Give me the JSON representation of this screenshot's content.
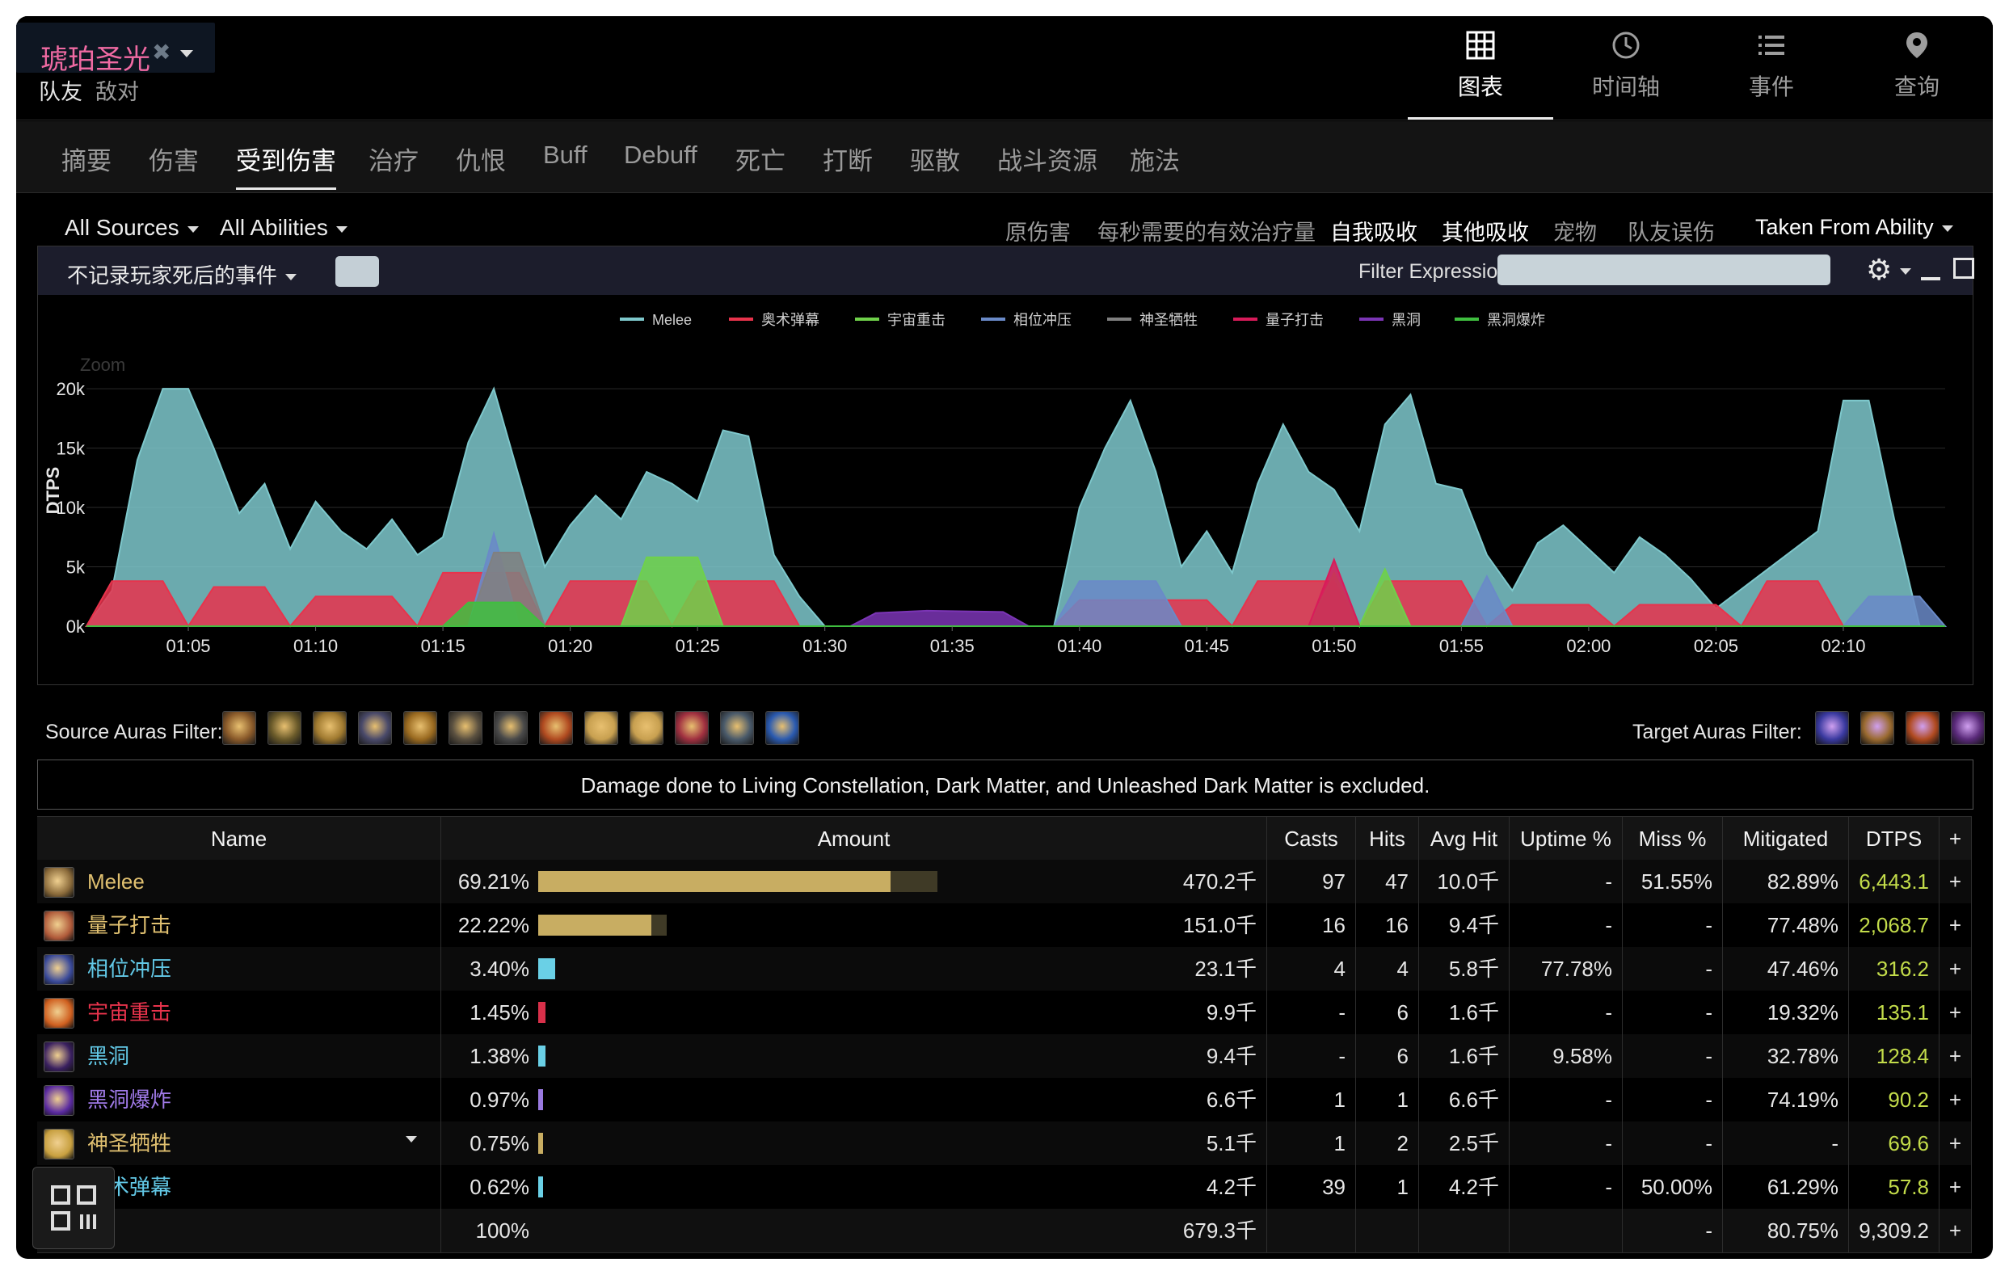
{
  "header": {
    "player_name": "琥珀圣光",
    "role_friend": "队友",
    "role_enemy": "敌对",
    "views": [
      {
        "label": "图表",
        "icon": "grid-icon",
        "active": true
      },
      {
        "label": "时间轴",
        "icon": "clock-icon",
        "active": false
      },
      {
        "label": "事件",
        "icon": "list-icon",
        "active": false
      },
      {
        "label": "查询",
        "icon": "location-pin-icon",
        "active": false
      }
    ]
  },
  "nav_tabs": [
    "摘要",
    "伤害",
    "受到伤害",
    "治疗",
    "仇恨",
    "Buff",
    "Debuff",
    "死亡",
    "打断",
    "驱散",
    "战斗资源",
    "施法"
  ],
  "nav_active": "受到伤害",
  "filters": {
    "sources": "All Sources",
    "abilities": "All Abilities",
    "options": [
      "原伤害",
      "每秒需要的有效治疗量",
      "自我吸收",
      "其他吸收",
      "宠物",
      "队友误伤"
    ],
    "options_active": [
      "自我吸收",
      "其他吸收"
    ],
    "taken_from": "Taken From Ability"
  },
  "chart_panel": {
    "death_option": "不记录玩家死后的事件",
    "filter_label": "Filter Expression:",
    "filter_value": ""
  },
  "chart_data": {
    "type": "area",
    "ylabel": "DTPS",
    "zoom_label": "Zoom",
    "y_ticks": [
      "0k",
      "5k",
      "10k",
      "15k",
      "20k"
    ],
    "ylim": [
      0,
      23000
    ],
    "x_ticks": [
      "01:05",
      "01:10",
      "01:15",
      "01:20",
      "01:25",
      "01:30",
      "01:35",
      "01:40",
      "01:45",
      "01:50",
      "01:55",
      "02:00",
      "02:05",
      "02:10"
    ],
    "xlim": [
      "01:01",
      "02:14"
    ],
    "grid": true,
    "legend_position": "top",
    "series": [
      {
        "name": "Melee",
        "color": "#7ec8cc",
        "points": [
          [
            "01:01",
            0
          ],
          [
            "01:02",
            3000
          ],
          [
            "01:03",
            14000
          ],
          [
            "01:04",
            20000
          ],
          [
            "01:05",
            20000
          ],
          [
            "01:06",
            15000
          ],
          [
            "01:07",
            9500
          ],
          [
            "01:08",
            12000
          ],
          [
            "01:09",
            6500
          ],
          [
            "01:10",
            10500
          ],
          [
            "01:11",
            8000
          ],
          [
            "01:12",
            6500
          ],
          [
            "01:13",
            9000
          ],
          [
            "01:14",
            6000
          ],
          [
            "01:15",
            7500
          ],
          [
            "01:16",
            15500
          ],
          [
            "01:17",
            20000
          ],
          [
            "01:18",
            12500
          ],
          [
            "01:19",
            5000
          ],
          [
            "01:20",
            8500
          ],
          [
            "01:21",
            11000
          ],
          [
            "01:22",
            9000
          ],
          [
            "01:23",
            13000
          ],
          [
            "01:24",
            12000
          ],
          [
            "01:25",
            10500
          ],
          [
            "01:26",
            16500
          ],
          [
            "01:27",
            16000
          ],
          [
            "01:28",
            6000
          ],
          [
            "01:29",
            2500
          ],
          [
            "01:30",
            0
          ],
          [
            "01:39",
            0
          ],
          [
            "01:40",
            10000
          ],
          [
            "01:41",
            15000
          ],
          [
            "01:42",
            19000
          ],
          [
            "01:43",
            13000
          ],
          [
            "01:44",
            5000
          ],
          [
            "01:45",
            8000
          ],
          [
            "01:46",
            4500
          ],
          [
            "01:47",
            12000
          ],
          [
            "01:48",
            17000
          ],
          [
            "01:49",
            13000
          ],
          [
            "01:50",
            11500
          ],
          [
            "01:51",
            8000
          ],
          [
            "01:52",
            17000
          ],
          [
            "01:53",
            19500
          ],
          [
            "01:54",
            12000
          ],
          [
            "01:55",
            11500
          ],
          [
            "01:56",
            6000
          ],
          [
            "01:57",
            3000
          ],
          [
            "01:58",
            7000
          ],
          [
            "01:59",
            8500
          ],
          [
            "02:00",
            6500
          ],
          [
            "02:01",
            4500
          ],
          [
            "02:02",
            7500
          ],
          [
            "02:03",
            6000
          ],
          [
            "02:04",
            4000
          ],
          [
            "02:05",
            1500
          ],
          [
            "02:09",
            8000
          ],
          [
            "02:10",
            19000
          ],
          [
            "02:11",
            19000
          ],
          [
            "02:12",
            9000
          ],
          [
            "02:13",
            0
          ]
        ]
      },
      {
        "name": "奥术弹幕",
        "color": "#e8334c",
        "points": [
          [
            "01:01",
            0
          ],
          [
            "01:02",
            3800
          ],
          [
            "01:04",
            3800
          ],
          [
            "01:05",
            0
          ],
          [
            "01:06",
            3300
          ],
          [
            "01:08",
            3300
          ],
          [
            "01:09",
            0
          ],
          [
            "01:10",
            2500
          ],
          [
            "01:13",
            2500
          ],
          [
            "01:14",
            0
          ],
          [
            "01:15",
            4500
          ],
          [
            "01:18",
            4500
          ],
          [
            "01:19",
            0
          ],
          [
            "01:20",
            3800
          ],
          [
            "01:23",
            3800
          ],
          [
            "01:24",
            0
          ],
          [
            "01:25",
            3800
          ],
          [
            "01:28",
            3800
          ],
          [
            "01:29",
            0
          ],
          [
            "01:39",
            0
          ],
          [
            "01:40",
            2200
          ],
          [
            "01:45",
            2200
          ],
          [
            "01:46",
            0
          ],
          [
            "01:47",
            3800
          ],
          [
            "01:50",
            3800
          ],
          [
            "01:51",
            0
          ],
          [
            "01:52",
            3800
          ],
          [
            "01:55",
            3800
          ],
          [
            "01:56",
            0
          ],
          [
            "01:57",
            1800
          ],
          [
            "02:00",
            1800
          ],
          [
            "02:01",
            0
          ],
          [
            "02:02",
            1800
          ],
          [
            "02:05",
            1800
          ],
          [
            "02:06",
            0
          ],
          [
            "02:07",
            3800
          ],
          [
            "02:09",
            3800
          ],
          [
            "02:10",
            0
          ]
        ]
      },
      {
        "name": "宇宙重击",
        "color": "#6fd14a",
        "points": [
          [
            "01:01",
            0
          ],
          [
            "01:16",
            0
          ],
          [
            "01:17",
            2000
          ],
          [
            "01:18",
            0
          ],
          [
            "01:22",
            0
          ],
          [
            "01:23",
            5800
          ],
          [
            "01:25",
            5800
          ],
          [
            "01:26",
            0
          ],
          [
            "01:49",
            0
          ],
          [
            "01:50",
            4500
          ],
          [
            "01:51",
            0
          ],
          [
            "01:52",
            4800
          ],
          [
            "01:53",
            0
          ]
        ]
      },
      {
        "name": "相位冲压",
        "color": "#6a8ac8",
        "points": [
          [
            "01:01",
            0
          ],
          [
            "01:16",
            0
          ],
          [
            "01:17",
            7800
          ],
          [
            "01:18",
            0
          ],
          [
            "01:39",
            0
          ],
          [
            "01:40",
            3800
          ],
          [
            "01:43",
            3800
          ],
          [
            "01:44",
            0
          ],
          [
            "01:55",
            0
          ],
          [
            "01:56",
            4200
          ],
          [
            "01:57",
            0
          ],
          [
            "02:10",
            0
          ],
          [
            "02:11",
            2500
          ],
          [
            "02:13",
            2500
          ],
          [
            "02:14",
            0
          ]
        ]
      },
      {
        "name": "神圣牺牲",
        "color": "#808080",
        "points": [
          [
            "01:01",
            0
          ],
          [
            "01:16",
            0
          ],
          [
            "01:17",
            6200
          ],
          [
            "01:18",
            6200
          ],
          [
            "01:19",
            0
          ]
        ]
      },
      {
        "name": "量子打击",
        "color": "#d81b5a",
        "points": [
          [
            "01:01",
            0
          ],
          [
            "01:49",
            0
          ],
          [
            "01:50",
            5600
          ],
          [
            "01:51",
            0
          ]
        ]
      },
      {
        "name": "黑洞",
        "color": "#7b35b5",
        "points": [
          [
            "01:01",
            0
          ],
          [
            "01:31",
            0
          ],
          [
            "01:32",
            1100
          ],
          [
            "01:34",
            1300
          ],
          [
            "01:37",
            1200
          ],
          [
            "01:38",
            0
          ]
        ]
      },
      {
        "name": "黑洞爆炸",
        "color": "#3fbf3f",
        "points": [
          [
            "01:01",
            0
          ],
          [
            "01:15",
            0
          ],
          [
            "01:16",
            2000
          ],
          [
            "01:18",
            2000
          ],
          [
            "01:19",
            0
          ]
        ]
      }
    ]
  },
  "auras": {
    "source_label": "Source Auras Filter:",
    "source_icons": [
      "shield-icon",
      "holy-light-icon",
      "golden-fist-icon",
      "sword-icon",
      "bronze-shield-icon",
      "crossed-axes-icon",
      "spear-icon",
      "flame-shield-icon",
      "glowing-hand-icon",
      "glowing-hand-icon",
      "red-shrine-icon",
      "weapon-icon",
      "blue-spark-icon"
    ],
    "target_label": "Target Auras Filter:",
    "target_icons": [
      "purple-rune-icon",
      "claw-icon",
      "fire-claw-icon",
      "void-icon"
    ]
  },
  "notice": "Damage done to Living Constellation, Dark Matter, and Unleashed Dark Matter is excluded.",
  "table": {
    "headers": {
      "name": "Name",
      "amount": "Amount",
      "casts": "Casts",
      "hits": "Hits",
      "avg": "Avg Hit",
      "uptime": "Uptime %",
      "miss": "Miss %",
      "mitigated": "Mitigated",
      "dtps": "DTPS",
      "plus": "+"
    },
    "rows": [
      {
        "name": "Melee",
        "name_color": "#e0c070",
        "icon": "melee-icon",
        "icon_color": "#8a6a3a",
        "pct": "69.21%",
        "bar": 0.6921,
        "bar_color": "#c8ad62",
        "amount": "470.2千",
        "casts": "97",
        "hits": "47",
        "avg": "10.0千",
        "uptime": "-",
        "miss": "51.55%",
        "mitigated": "82.89%",
        "dtps": "6,443.1",
        "plus": "+"
      },
      {
        "name": "量子打击",
        "name_color": "#e0c070",
        "icon": "quantum-strike-icon",
        "icon_color": "#b05a3a",
        "pct": "22.22%",
        "bar": 0.2222,
        "bar_color": "#c8ad62",
        "amount": "151.0千",
        "casts": "16",
        "hits": "16",
        "avg": "9.4千",
        "uptime": "-",
        "miss": "-",
        "mitigated": "77.48%",
        "dtps": "2,068.7",
        "plus": "+"
      },
      {
        "name": "相位冲压",
        "name_color": "#62c8e6",
        "icon": "phase-press-icon",
        "icon_color": "#3a4a9a",
        "pct": "3.40%",
        "bar": 0.034,
        "bar_color": "#6ad0e6",
        "amount": "23.1千",
        "casts": "4",
        "hits": "4",
        "avg": "5.8千",
        "uptime": "77.78%",
        "miss": "-",
        "mitigated": "47.46%",
        "dtps": "316.2",
        "plus": "+"
      },
      {
        "name": "宇宙重击",
        "name_color": "#e8334c",
        "icon": "cosmic-smash-icon",
        "icon_color": "#d06020",
        "pct": "1.45%",
        "bar": 0.0145,
        "bar_color": "#d8304a",
        "amount": "9.9千",
        "casts": "-",
        "hits": "6",
        "avg": "1.6千",
        "uptime": "-",
        "miss": "-",
        "mitigated": "19.32%",
        "dtps": "135.1",
        "plus": "+"
      },
      {
        "name": "黑洞",
        "name_color": "#62c8e6",
        "icon": "black-hole-icon",
        "icon_color": "#3a2060",
        "pct": "1.38%",
        "bar": 0.0138,
        "bar_color": "#6ad0e6",
        "amount": "9.4千",
        "casts": "-",
        "hits": "6",
        "avg": "1.6千",
        "uptime": "9.58%",
        "miss": "-",
        "mitigated": "32.78%",
        "dtps": "128.4",
        "plus": "+"
      },
      {
        "name": "黑洞爆炸",
        "name_color": "#a07ae8",
        "icon": "black-hole-burst-icon",
        "icon_color": "#5a2aa0",
        "pct": "0.97%",
        "bar": 0.0097,
        "bar_color": "#9a7ae0",
        "amount": "6.6千",
        "casts": "1",
        "hits": "1",
        "avg": "6.6千",
        "uptime": "-",
        "miss": "-",
        "mitigated": "74.19%",
        "dtps": "90.2",
        "plus": "+"
      },
      {
        "name": "神圣牺牲",
        "name_color": "#e0c070",
        "icon": "holy-sacrifice-icon",
        "icon_color": "#c8a040",
        "pct": "0.75%",
        "bar": 0.0075,
        "bar_color": "#c8ad62",
        "amount": "5.1千",
        "casts": "1",
        "hits": "2",
        "avg": "2.5千",
        "uptime": "-",
        "miss": "-",
        "mitigated": "-",
        "dtps": "69.6",
        "plus": "+"
      },
      {
        "name": "奥术弹幕",
        "name_color": "#62c8e6",
        "icon": "arcane-barrage-icon",
        "icon_color": "#3a4a7a",
        "pct": "0.62%",
        "bar": 0.0062,
        "bar_color": "#6ad0e6",
        "amount": "4.2千",
        "casts": "39",
        "hits": "1",
        "avg": "4.2千",
        "uptime": "-",
        "miss": "50.00%",
        "mitigated": "61.29%",
        "dtps": "57.8",
        "plus": "+"
      }
    ],
    "total": {
      "pct": "100%",
      "amount": "679.3千",
      "miss": "-",
      "mitigated": "80.75%",
      "dtps": "9,309.2",
      "plus": "+"
    }
  }
}
